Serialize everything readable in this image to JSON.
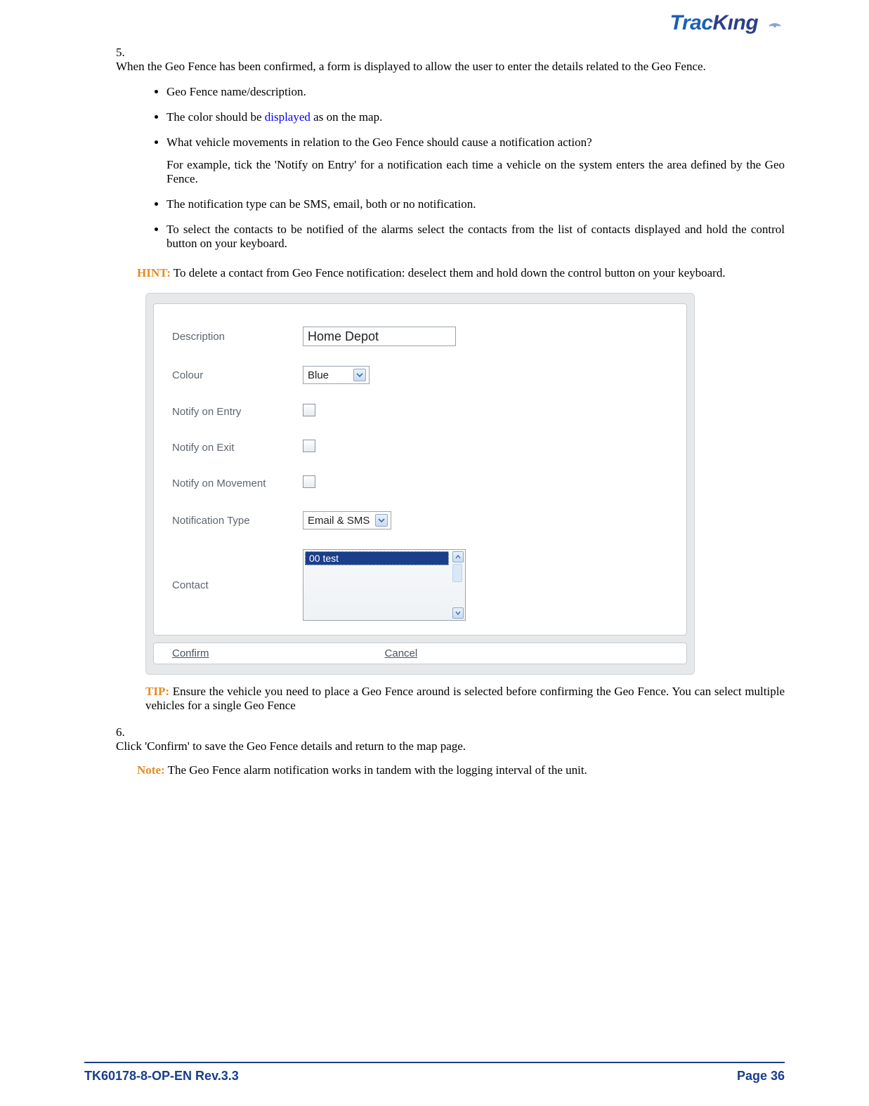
{
  "logo": {
    "part1": "Trac",
    "part2": "Kıng"
  },
  "step5": {
    "number": "5.",
    "text": "When the Geo Fence has been confirmed, a form is displayed to allow the user to enter the details related to the Geo Fence.",
    "bullets": {
      "b1": "Geo Fence name/description.",
      "b2_pre": "The color should be ",
      "b2_link": "displayed",
      "b2_post": " as on the map.",
      "b3_main": "What vehicle movements in relation to the Geo Fence should cause a notification action?",
      "b3_sub": "For example, tick the 'Notify on Entry' for a notification each time a vehicle on the system enters the area defined by the Geo Fence.",
      "b4": "The notification type can be SMS, email, both or no notification.",
      "b5": "To select the contacts to be notified of the alarms select the contacts from the list of contacts displayed and hold the control button on your keyboard."
    }
  },
  "hint": {
    "label": "HINT:",
    "text": " To delete a contact from Geo Fence notification: deselect them and hold down the control button on your keyboard."
  },
  "form": {
    "labels": {
      "description": "Description",
      "colour": "Colour",
      "notify_entry": "Notify on Entry",
      "notify_exit": "Notify on Exit",
      "notify_move": "Notify on Movement",
      "notif_type": "Notification Type",
      "contact": "Contact"
    },
    "values": {
      "description": "Home Depot",
      "colour": "Blue",
      "notif_type": "Email & SMS",
      "contact_item": "00 test"
    },
    "actions": {
      "confirm": "Confirm",
      "cancel": "Cancel"
    }
  },
  "tip": {
    "label": "TIP:",
    "text": " Ensure the vehicle you need to place a Geo Fence around is selected before confirming the Geo Fence. You can select multiple vehicles for a single Geo Fence"
  },
  "step6": {
    "number": "6.",
    "text": "Click 'Confirm' to save the Geo Fence details and return to the map page."
  },
  "note": {
    "label": "Note:",
    "text": " The Geo Fence alarm notification works in tandem with the logging interval of the unit."
  },
  "footer": {
    "left": "TK60178-8-OP-EN Rev.3.3",
    "right_label": "Page  ",
    "right_num": "36"
  }
}
